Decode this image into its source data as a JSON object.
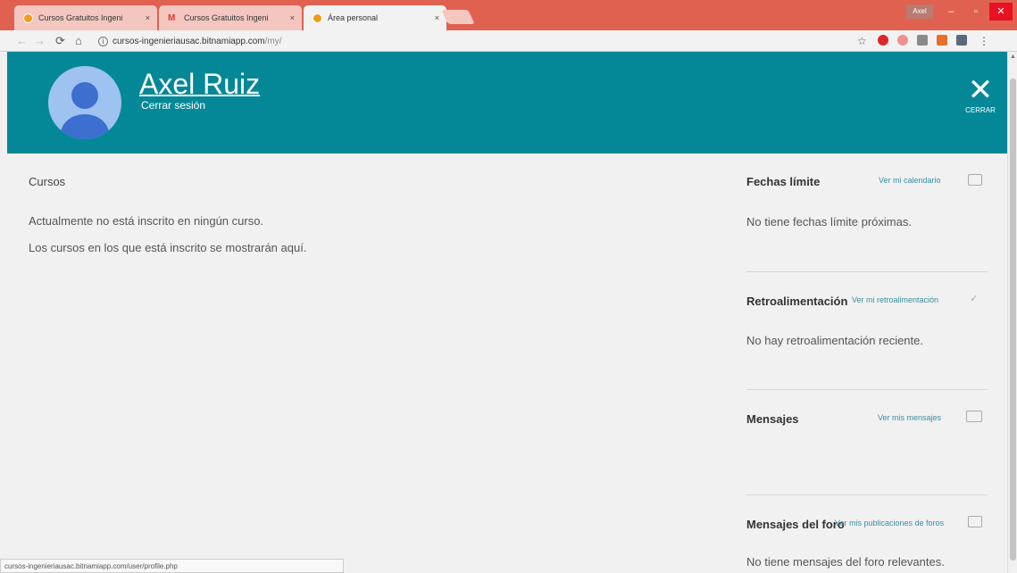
{
  "browser": {
    "tabs": [
      {
        "title": "Cursos Gratuitos Ingeni",
        "close": "×"
      },
      {
        "title": "Cursos Gratuitos Ingeni",
        "close": "×"
      },
      {
        "title": "Área personal",
        "close": "×"
      }
    ],
    "profile": "Axel",
    "window": {
      "minimize": "–",
      "maximize": "▫",
      "close": "✕"
    },
    "url_host": "cursos-ingenieriausac.bitnamiapp.com",
    "url_path": "/my/",
    "status_url": "cursos-ingenieriausac.bitnamiapp.com/user/profile.php"
  },
  "header": {
    "user_name": "Axel Ruiz",
    "logout": "Cerrar sesión",
    "close_label": "CERRAR"
  },
  "courses": {
    "title": "Cursos",
    "message1": "Actualmente no está inscrito en ningún curso.",
    "message2": "Los cursos en los que está inscrito se mostrarán aquí."
  },
  "sidebar": {
    "deadlines": {
      "title": "Fechas límite",
      "link": "Ver mi calendario",
      "text": "No tiene fechas límite próximas."
    },
    "feedback": {
      "title": "Retroalimentación",
      "link": "Ver mi retroalimentación",
      "text": "No hay retroalimentación reciente."
    },
    "messages": {
      "title": "Mensajes",
      "link": "Ver mis mensajes"
    },
    "forum": {
      "title": "Mensajes del foro",
      "link": "Ver mis publicaciones de foros",
      "text": "No tiene mensajes del foro relevantes."
    }
  }
}
